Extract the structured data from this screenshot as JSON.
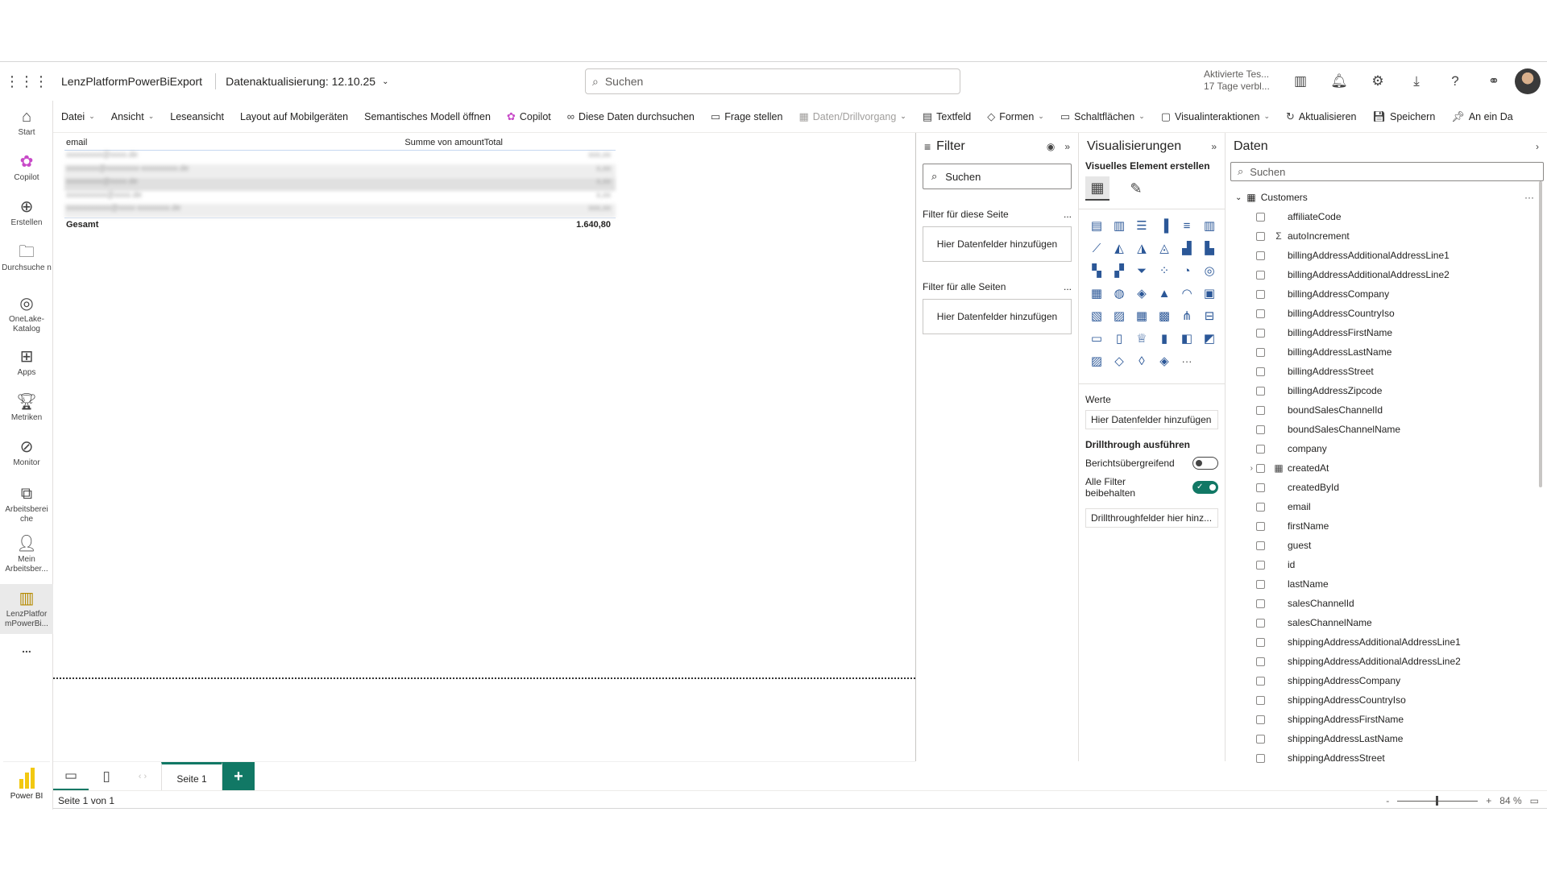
{
  "header": {
    "app_name": "LenzPlatformPowerBiExport",
    "refresh_label": "Datenaktualisierung: 12.10.25",
    "search_placeholder": "Suchen",
    "trial_line1": "Aktivierte Tes...",
    "trial_line2": "17 Tage verbl..."
  },
  "leftnav": {
    "items": [
      {
        "label": "Start",
        "icon": "home-icon"
      },
      {
        "label": "Copilot",
        "icon": "copilot-icon"
      },
      {
        "label": "Erstellen",
        "icon": "plus-circle-icon"
      },
      {
        "label": "Durchsuche n",
        "icon": "folder-icon"
      },
      {
        "label": "OneLake-Katalog",
        "icon": "onelake-icon"
      },
      {
        "label": "Apps",
        "icon": "apps-icon"
      },
      {
        "label": "Metriken",
        "icon": "trophy-icon"
      },
      {
        "label": "Monitor",
        "icon": "monitor-icon"
      },
      {
        "label": "Arbeitsberei che",
        "icon": "workspaces-icon"
      },
      {
        "label": "Mein Arbeitsber...",
        "icon": "person-icon"
      },
      {
        "label": "LenzPlatfor mPowerBi...",
        "icon": "report-icon"
      }
    ],
    "more": "...",
    "brand": "Power BI"
  },
  "ribbon": {
    "datei": "Datei",
    "ansicht": "Ansicht",
    "leseansicht": "Leseansicht",
    "layout_mobil": "Layout auf Mobilgeräten",
    "semantisches_modell": "Semantisches Modell öffnen",
    "copilot": "Copilot",
    "daten_durchsuchen": "Diese Daten durchsuchen",
    "frage_stellen": "Frage stellen",
    "daten_drill": "Daten/Drillvorgang",
    "textfeld": "Textfeld",
    "formen": "Formen",
    "schaltflaechen": "Schaltflächen",
    "visualinteraktionen": "Visualinteraktionen",
    "aktualisieren": "Aktualisieren",
    "speichern": "Speichern",
    "an_ein": "An ein Da"
  },
  "table": {
    "col_email": "email",
    "col_sum": "Summe von amountTotal",
    "rows": [
      {
        "email": "xxxxxxxxx@xxxx.de",
        "value": "xxx,xx"
      },
      {
        "email": "xxxxxxxx@xxxxxxxx-xxxxxxxxx.de",
        "value": "x,xx"
      },
      {
        "email": "xxxxxxxxx@xxxx.de",
        "value": "x,xx"
      },
      {
        "email": "xxxxxxxxxx@xxxx.de",
        "value": "x,xx"
      },
      {
        "email": "xxxxxxxxxxx@xxxx-xxxxxxxx.de",
        "value": "xxx,xx"
      }
    ],
    "total_label": "Gesamt",
    "total_value": "1.640,80"
  },
  "pages": {
    "current_tab": "Seite 1",
    "add": "+",
    "status": "Seite 1 von 1"
  },
  "zoom": {
    "minus": "-",
    "plus": "+",
    "value": "84 %"
  },
  "filter": {
    "title": "Filter",
    "search_placeholder": "Suchen",
    "this_page": "Filter für diese Seite",
    "all_pages": "Filter für alle Seiten",
    "drop_hint_1": "Hier Datenfelder hinzufügen",
    "drop_hint_2": "Hier Datenfelder hinzufügen",
    "more": "..."
  },
  "viz": {
    "title": "Visualisierungen",
    "build_label": "Visuelles Element erstellen",
    "werte": "Werte",
    "werte_drop": "Hier Datenfelder hinzufügen",
    "drillthrough": "Drillthrough ausführen",
    "cross_report": "Berichtsübergreifend",
    "cross_report_on": false,
    "keep_filters": "Alle Filter beibehalten",
    "keep_filters_on": true,
    "drill_drop": "Drillthroughfelder hier hinz...",
    "more": "···",
    "icons": [
      "stacked-bar-icon",
      "stacked-column-icon",
      "clustered-bar-icon",
      "clustered-column-icon",
      "100-bar-icon",
      "100-column-icon",
      "line-icon",
      "area-icon",
      "stacked-area-icon",
      "100-area-icon",
      "line-column-icon",
      "line-clustered-icon",
      "ribbon-icon",
      "waterfall-icon",
      "funnel-icon",
      "scatter-icon",
      "pie-icon",
      "donut-icon",
      "treemap-icon",
      "map-icon",
      "filled-map-icon",
      "azure-map-icon",
      "gauge-icon",
      "card-icon",
      "kpi-icon",
      "slicer-icon",
      "table-icon",
      "matrix-icon",
      "decomposition-icon",
      "key-influencers-icon",
      "qa-icon",
      "narrative-icon",
      "trophy-icon",
      "paginated-icon",
      "power-apps-icon",
      "power-automate-icon",
      "image-icon",
      "shape-icon",
      "r-visual-icon",
      "python-visual-icon"
    ]
  },
  "data": {
    "title": "Daten",
    "search_placeholder": "Suchen",
    "table_name": "Customers",
    "more": "···",
    "fields": [
      {
        "name": "affiliateCode",
        "type": ""
      },
      {
        "name": "autoIncrement",
        "type": "Σ"
      },
      {
        "name": "billingAddressAdditionalAddressLine1",
        "type": ""
      },
      {
        "name": "billingAddressAdditionalAddressLine2",
        "type": ""
      },
      {
        "name": "billingAddressCompany",
        "type": ""
      },
      {
        "name": "billingAddressCountryIso",
        "type": ""
      },
      {
        "name": "billingAddressFirstName",
        "type": ""
      },
      {
        "name": "billingAddressLastName",
        "type": ""
      },
      {
        "name": "billingAddressStreet",
        "type": ""
      },
      {
        "name": "billingAddressZipcode",
        "type": ""
      },
      {
        "name": "boundSalesChannelId",
        "type": ""
      },
      {
        "name": "boundSalesChannelName",
        "type": ""
      },
      {
        "name": "company",
        "type": ""
      },
      {
        "name": "createdAt",
        "type": "▦",
        "expandable": true
      },
      {
        "name": "createdById",
        "type": ""
      },
      {
        "name": "email",
        "type": ""
      },
      {
        "name": "firstName",
        "type": ""
      },
      {
        "name": "guest",
        "type": ""
      },
      {
        "name": "id",
        "type": ""
      },
      {
        "name": "lastName",
        "type": ""
      },
      {
        "name": "salesChannelId",
        "type": ""
      },
      {
        "name": "salesChannelName",
        "type": ""
      },
      {
        "name": "shippingAddressAdditionalAddressLine1",
        "type": ""
      },
      {
        "name": "shippingAddressAdditionalAddressLine2",
        "type": ""
      },
      {
        "name": "shippingAddressCompany",
        "type": ""
      },
      {
        "name": "shippingAddressCountryIso",
        "type": ""
      },
      {
        "name": "shippingAddressFirstName",
        "type": ""
      },
      {
        "name": "shippingAddressLastName",
        "type": ""
      },
      {
        "name": "shippingAddressStreet",
        "type": ""
      }
    ]
  },
  "colors": {
    "accent": "#117865",
    "brand_yellow": "#f2c811"
  }
}
